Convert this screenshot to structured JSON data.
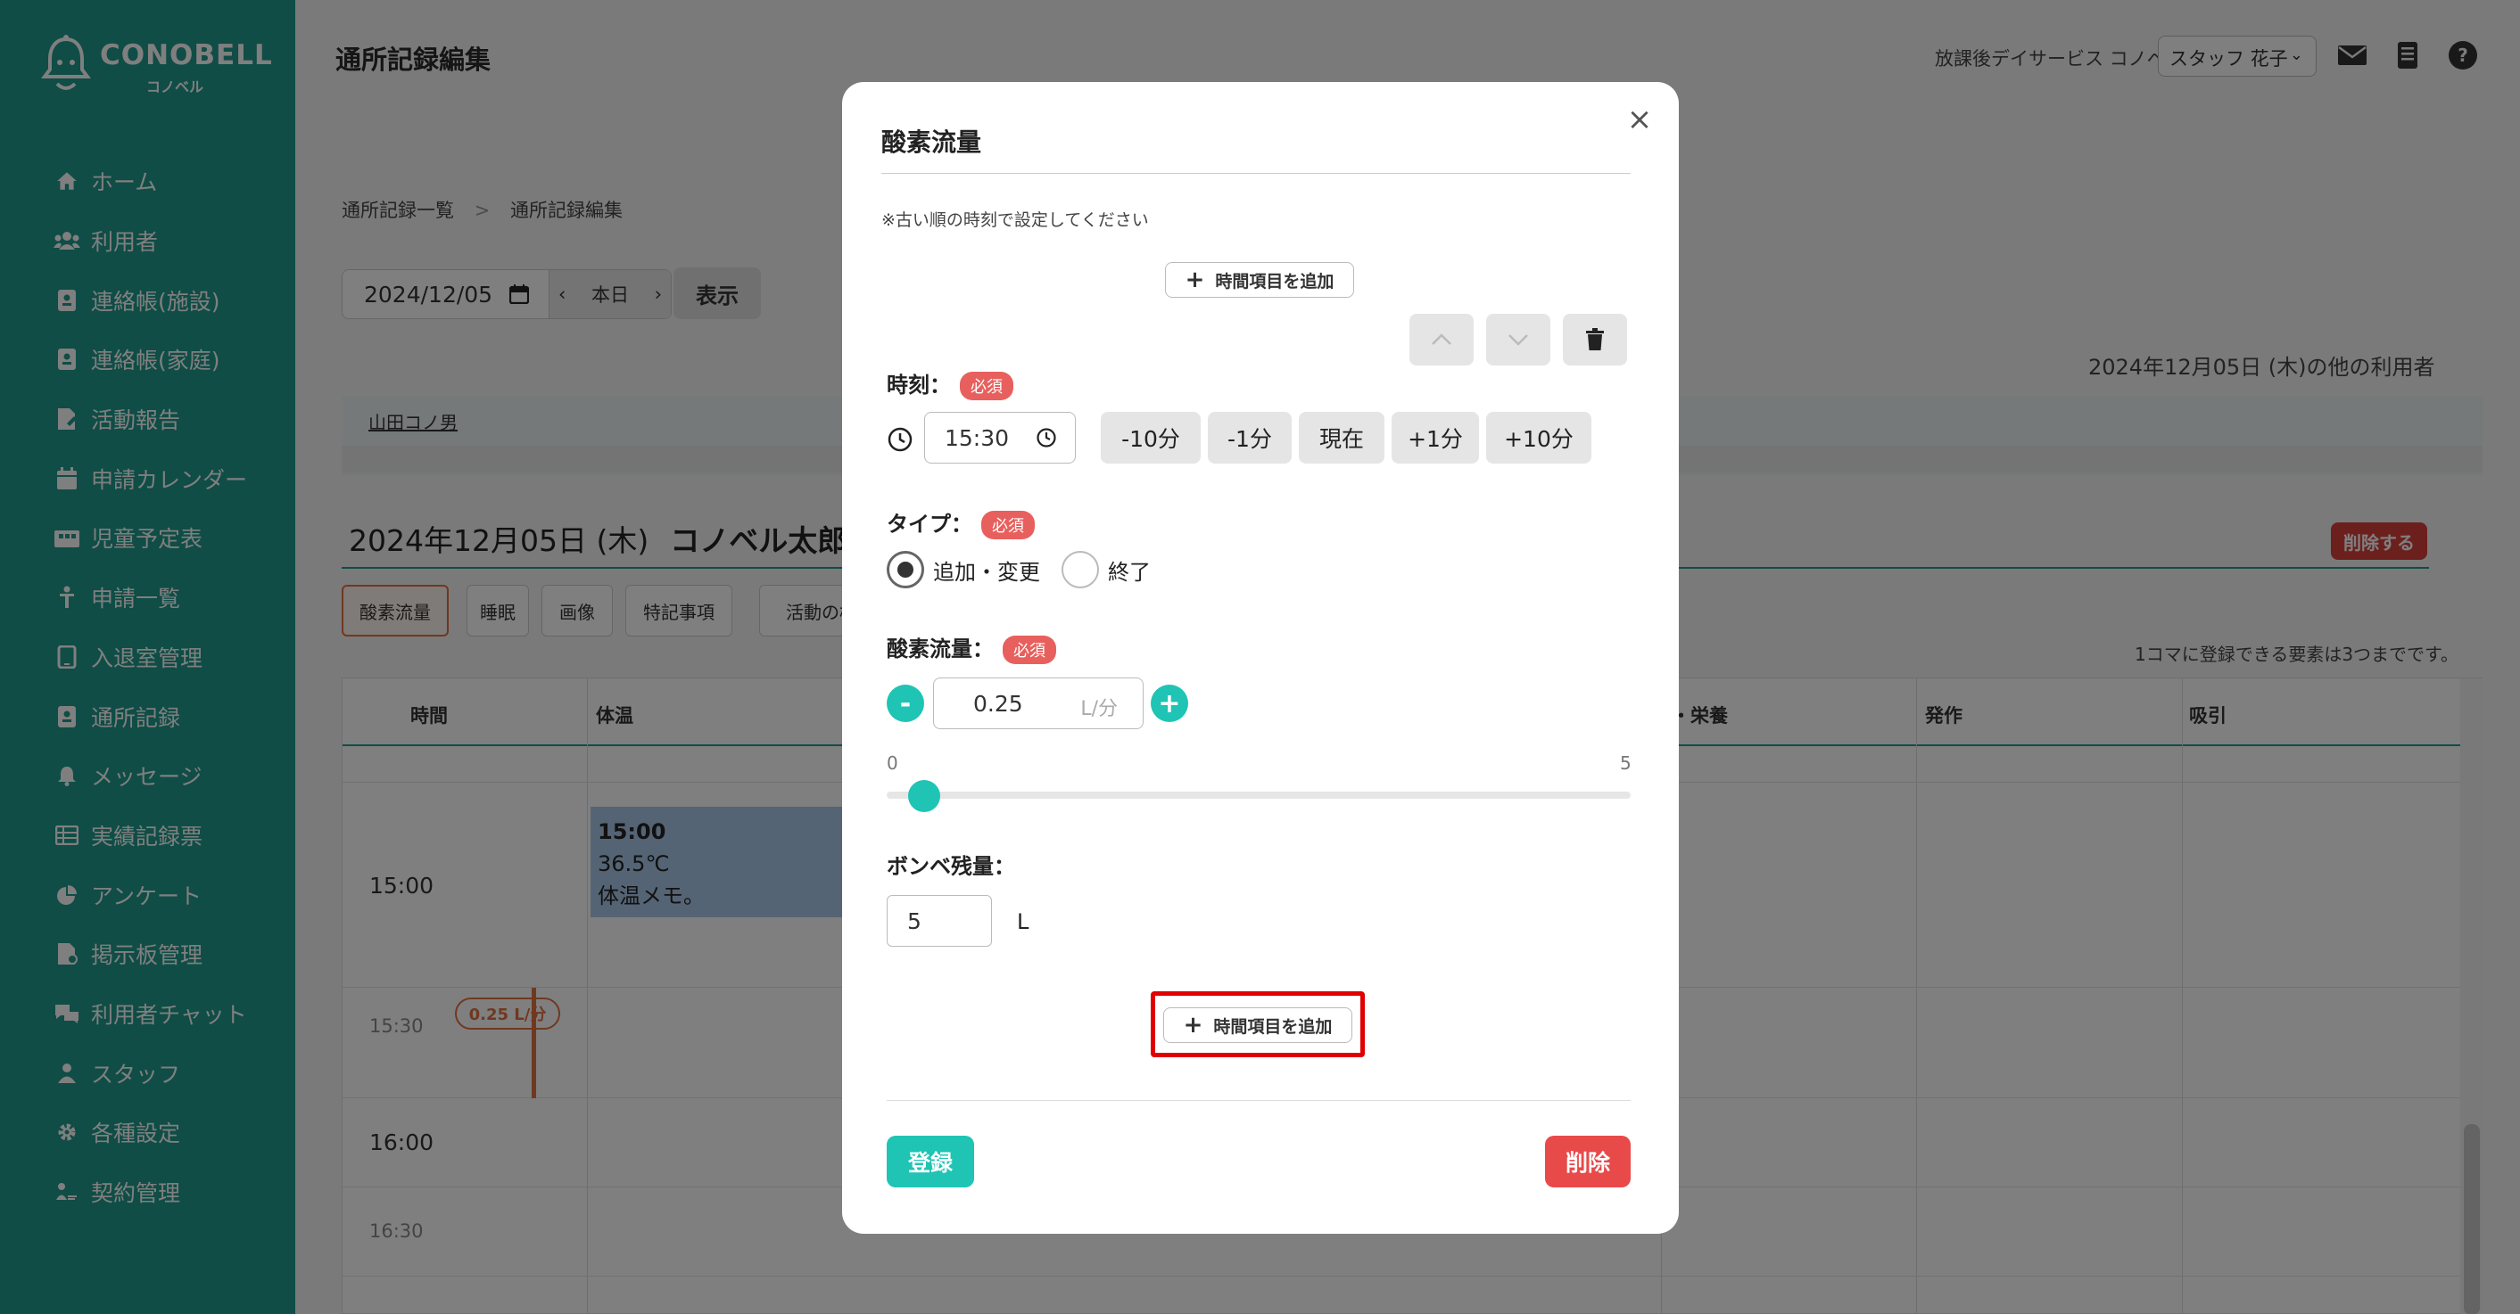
{
  "brand": {
    "name": "CONOBELL",
    "sub": "コノベル"
  },
  "sidebar": {
    "items": [
      {
        "label": "ホーム",
        "icon": "home-icon"
      },
      {
        "label": "利用者",
        "icon": "users-icon"
      },
      {
        "label": "連絡帳(施設)",
        "icon": "contact-book-icon"
      },
      {
        "label": "連絡帳(家庭)",
        "icon": "contact-book-icon"
      },
      {
        "label": "活動報告",
        "icon": "report-icon"
      },
      {
        "label": "申請カレンダー",
        "icon": "calendar-icon"
      },
      {
        "label": "児童予定表",
        "icon": "schedule-icon"
      },
      {
        "label": "申請一覧",
        "icon": "person-icon"
      },
      {
        "label": "入退室管理",
        "icon": "tablet-icon"
      },
      {
        "label": "通所記録",
        "icon": "record-icon"
      },
      {
        "label": "メッセージ",
        "icon": "bell-icon"
      },
      {
        "label": "実績記録票",
        "icon": "table-icon"
      },
      {
        "label": "アンケート",
        "icon": "pie-icon"
      },
      {
        "label": "掲示板管理",
        "icon": "board-icon"
      },
      {
        "label": "利用者チャット",
        "icon": "chat-icon"
      },
      {
        "label": "スタッフ",
        "icon": "staff-icon"
      },
      {
        "label": "各種設定",
        "icon": "gear-icon"
      },
      {
        "label": "契約管理",
        "icon": "contract-icon"
      }
    ]
  },
  "header": {
    "title": "通所記録編集",
    "org": "放課後デイサービス コノベル",
    "staff": "スタッフ 花子"
  },
  "breadcrumb": {
    "item1": "通所記録一覧",
    "sep": ">",
    "item2": "通所記録編集"
  },
  "filters": {
    "date": "2024/12/05",
    "today": "本日",
    "show": "表示"
  },
  "other_users": "2024年12月05日 (木)の他の利用者",
  "user_chip": "山田コノ男",
  "day": {
    "date": "2024年12月05日 (木)",
    "name": "コノベル太郎",
    "delete": "削除する"
  },
  "chips": [
    "酸素流量",
    "睡眠",
    "画像",
    "特記事項",
    "活動の様"
  ],
  "max_note": "1コマに登録できる要素は3つまでです。",
  "grid": {
    "headers": {
      "time": "時間",
      "temp": "体温",
      "nutrition": "・栄養",
      "seizure": "発作",
      "suction": "吸引"
    },
    "times": [
      "15:00",
      "15:30",
      "16:00",
      "16:30"
    ],
    "temp_card": {
      "time": "15:00",
      "value": "36.5℃",
      "memo": "体温メモ。"
    },
    "oxygen_badge": "0.25 L/分"
  },
  "modal": {
    "title": "酸素流量",
    "close": "×",
    "note": "※古い順の時刻で設定してください",
    "add_time_item": "時間項目を追加",
    "time_label": "時刻：",
    "required": "必須",
    "time_value": "15:30",
    "adjust": [
      "-10分",
      "-1分",
      "現在",
      "+1分",
      "+10分"
    ],
    "type_label": "タイプ：",
    "type_options": [
      "追加・変更",
      "終了"
    ],
    "type_selected": "追加・変更",
    "flow_label": "酸素流量：",
    "flow_value": "0.25",
    "flow_unit": "L/分",
    "minus": "-",
    "plus": "+",
    "range_min": "0",
    "range_max": "5",
    "slider_value": 0.25,
    "cylinder_label": "ボンベ残量：",
    "cylinder_value": "5",
    "cylinder_unit": "L",
    "save": "登録",
    "delete": "削除"
  },
  "colors": {
    "sidebar": "#1f9a8d",
    "accent": "#1fc4b4",
    "danger": "#e84a4a",
    "highlight": "#e00000"
  }
}
